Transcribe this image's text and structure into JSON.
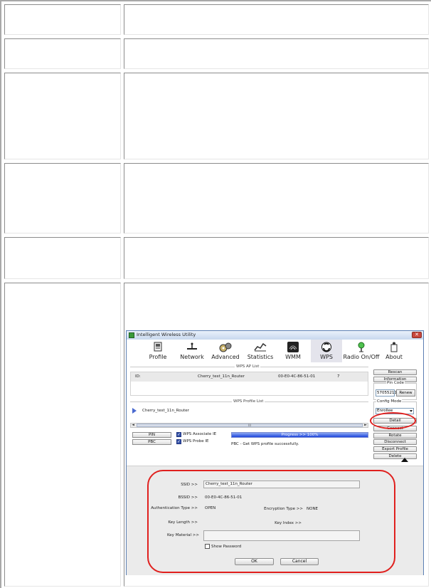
{
  "window": {
    "title": "Intelligent Wireless Utility",
    "close_glyph": "✕"
  },
  "toolbar": [
    {
      "label": "Profile",
      "icon": "profile-icon"
    },
    {
      "label": "Network",
      "icon": "network-icon"
    },
    {
      "label": "Advanced",
      "icon": "advanced-icon"
    },
    {
      "label": "Statistics",
      "icon": "statistics-icon"
    },
    {
      "label": "WMM",
      "icon": "wmm-icon"
    },
    {
      "label": "WPS",
      "icon": "wps-icon",
      "active": true
    },
    {
      "label": "Radio On/Off",
      "icon": "radio-icon"
    },
    {
      "label": "About",
      "icon": "about-icon"
    }
  ],
  "wps_ap_list": {
    "label": "WPS AP List",
    "row": {
      "id_label": "ID:",
      "ssid": "Cherry_test_11n_Router",
      "mac": "00-E0-4C-86-51-01",
      "channel": "7"
    }
  },
  "wps_profile_list": {
    "label": "WPS Profile List",
    "item": "Cherry_test_11n_Router"
  },
  "scroll": {
    "left": "◄",
    "right": "►",
    "thumb": "III"
  },
  "right_buttons": {
    "rescan": "Rescan",
    "information": "Information",
    "pin_code_label": "Pin Code",
    "pin_code_value": "57055211",
    "renew": "Renew",
    "config_mode_label": "Config Mode",
    "config_mode_value": "Enrollee",
    "detail": "Detail",
    "connect": "Connect",
    "rotate": "Rotate",
    "disconnect": "Disconnect",
    "export_profile": "Export Profile",
    "delete": "Delete"
  },
  "method_buttons": {
    "pin": "PIN",
    "pbc": "PBC"
  },
  "checkboxes": {
    "associate": "WPS Associate IE",
    "probe": "WPS Probe IE",
    "check": "✓"
  },
  "progress": {
    "text": "Progress >> 100%",
    "value": 100
  },
  "status_text": "PBC - Get WPS profile successfully.",
  "detail": {
    "ssid_label": "SSID >>",
    "ssid_value": "Cherry_test_11n_Router",
    "bssid_label": "BSSID >>",
    "bssid_value": "00-E0-4C-86-51-01",
    "auth_label": "Authentication Type >>",
    "auth_value": "OPEN",
    "enc_label": "Encryption Type >>",
    "enc_value": "NONE",
    "key_length_label": "Key Length >>",
    "key_index_label": "Key Index >>",
    "key_material_label": "Key Material >>",
    "key_material_value": "",
    "show_password": "Show Password",
    "ok": "OK",
    "cancel": "Cancel"
  },
  "colors": {
    "highlight": "#e0201e",
    "progress": "#1f46dc",
    "window_border": "#5c7fb3"
  }
}
